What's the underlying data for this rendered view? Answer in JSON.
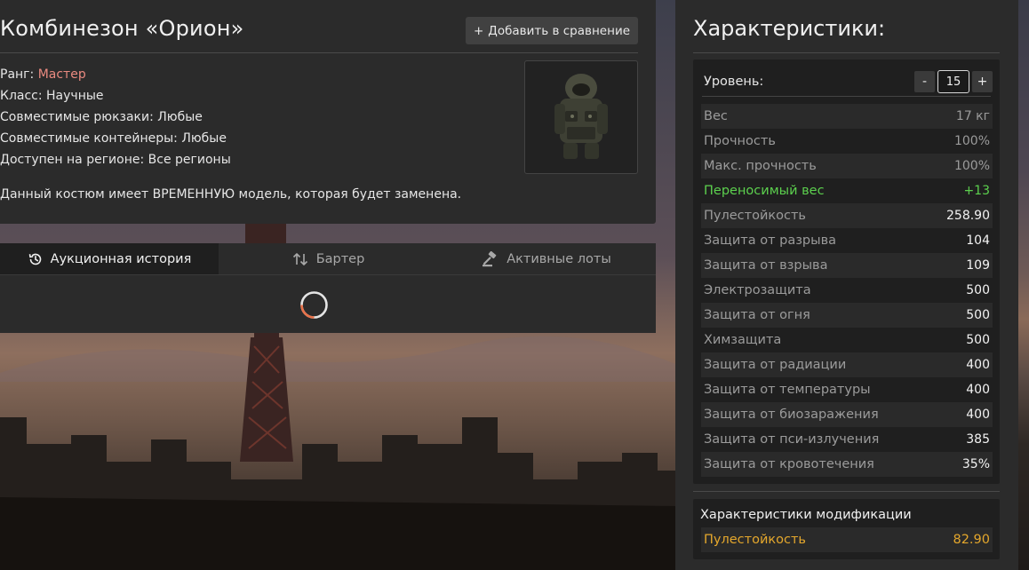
{
  "item": {
    "title": "Комбинезон «Орион»",
    "compare_button": "Добавить в сравнение",
    "props": [
      {
        "label": "Ранг: ",
        "value": "Мастер"
      },
      {
        "label": "Класс: ",
        "value": "Научные"
      },
      {
        "label": "Совместимые рюкзаки: ",
        "value": "Любые"
      },
      {
        "label": "Совместимые контейнеры: ",
        "value": "Любые"
      },
      {
        "label": "Доступен на регионе: ",
        "value": "Все регионы"
      }
    ],
    "notice": "Данный костюм имеет ВРЕМЕННУЮ модель, которая будет заменена."
  },
  "tabs": [
    {
      "label": "Аукционная история",
      "icon": "history-icon"
    },
    {
      "label": "Бартер",
      "icon": "swap-icon"
    },
    {
      "label": "Активные лоты",
      "icon": "gavel-icon"
    }
  ],
  "stats": {
    "title": "Характеристики:",
    "level_label": "Уровень:",
    "level_value": "15",
    "minus": "-",
    "plus": "+",
    "rows": [
      {
        "k": "Вес",
        "v": "17 кг",
        "style": "dim"
      },
      {
        "k": "Прочность",
        "v": "100%",
        "style": "dim"
      },
      {
        "k": "Макс. прочность",
        "v": "100%",
        "style": "dim"
      },
      {
        "k": "Переносимый вес",
        "v": "+13",
        "style": "green"
      },
      {
        "k": "Пулестойкость",
        "v": "258.90",
        "style": ""
      },
      {
        "k": "Защита от разрыва",
        "v": "104",
        "style": ""
      },
      {
        "k": "Защита от взрыва",
        "v": "109",
        "style": ""
      },
      {
        "k": "Электрозащита",
        "v": "500",
        "style": ""
      },
      {
        "k": "Защита от огня",
        "v": "500",
        "style": ""
      },
      {
        "k": "Химзащита",
        "v": "500",
        "style": ""
      },
      {
        "k": "Защита от радиации",
        "v": "400",
        "style": ""
      },
      {
        "k": "Защита от температуры",
        "v": "400",
        "style": ""
      },
      {
        "k": "Защита от биозаражения",
        "v": "400",
        "style": ""
      },
      {
        "k": "Защита от пси-излучения",
        "v": "385",
        "style": ""
      },
      {
        "k": "Защита от кровотечения",
        "v": "35%",
        "style": ""
      }
    ],
    "mod_title": "Характеристики модификации",
    "mod_row": {
      "k": "Пулестойкость",
      "v": "82.90"
    }
  },
  "colors": {
    "rank": "#ea8a80",
    "positive": "#5cd04e",
    "modification": "#e4a72c"
  }
}
